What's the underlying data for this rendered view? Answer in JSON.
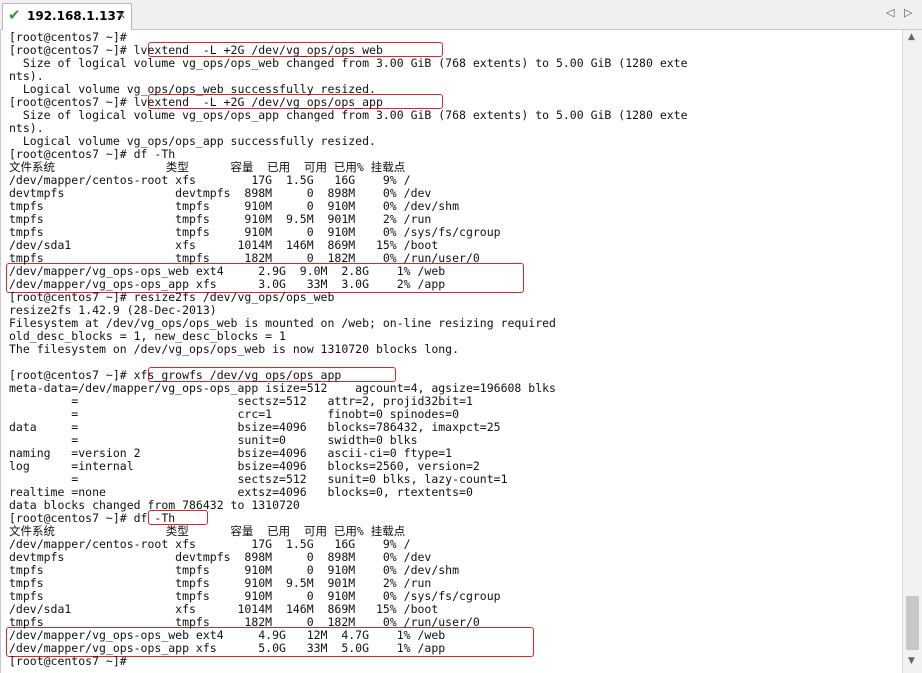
{
  "window": {
    "tab_title": "192.168.1.137",
    "tab_status_icon": "check-icon",
    "tab_close_icon": "close-icon",
    "nav_left_icon": "chevron-left-icon",
    "nav_right_icon": "chevron-right-icon",
    "highlight_color": "#d42a2a"
  },
  "terminal": {
    "lines": [
      "[root@centos7 ~]#",
      "[root@centos7 ~]# lvextend  -L +2G /dev/vg_ops/ops_web",
      "  Size of logical volume vg_ops/ops_web changed from 3.00 GiB (768 extents) to 5.00 GiB (1280 exte",
      "nts).",
      "  Logical volume vg_ops/ops_web successfully resized.",
      "[root@centos7 ~]# lvextend  -L +2G /dev/vg_ops/ops_app",
      "  Size of logical volume vg_ops/ops_app changed from 3.00 GiB (768 extents) to 5.00 GiB (1280 exte",
      "nts).",
      "  Logical volume vg_ops/ops_app successfully resized.",
      "[root@centos7 ~]# df -Th",
      "文件系统                类型      容量  已用  可用 已用% 挂载点",
      "/dev/mapper/centos-root xfs        17G  1.5G   16G    9% /",
      "devtmpfs                devtmpfs  898M     0  898M    0% /dev",
      "tmpfs                   tmpfs     910M     0  910M    0% /dev/shm",
      "tmpfs                   tmpfs     910M  9.5M  901M    2% /run",
      "tmpfs                   tmpfs     910M     0  910M    0% /sys/fs/cgroup",
      "/dev/sda1               xfs      1014M  146M  869M   15% /boot",
      "tmpfs                   tmpfs     182M     0  182M    0% /run/user/0",
      "/dev/mapper/vg_ops-ops_web ext4     2.9G  9.0M  2.8G    1% /web",
      "/dev/mapper/vg_ops-ops_app xfs      3.0G   33M  3.0G    2% /app",
      "[root@centos7 ~]# resize2fs /dev/vg_ops/ops_web",
      "resize2fs 1.42.9 (28-Dec-2013)",
      "Filesystem at /dev/vg_ops/ops_web is mounted on /web; on-line resizing required",
      "old_desc_blocks = 1, new_desc_blocks = 1",
      "The filesystem on /dev/vg_ops/ops_web is now 1310720 blocks long.",
      "",
      "[root@centos7 ~]# xfs_growfs /dev/vg_ops/ops_app",
      "meta-data=/dev/mapper/vg_ops-ops_app isize=512    agcount=4, agsize=196608 blks",
      "         =                       sectsz=512   attr=2, projid32bit=1",
      "         =                       crc=1        finobt=0 spinodes=0",
      "data     =                       bsize=4096   blocks=786432, imaxpct=25",
      "         =                       sunit=0      swidth=0 blks",
      "naming   =version 2              bsize=4096   ascii-ci=0 ftype=1",
      "log      =internal               bsize=4096   blocks=2560, version=2",
      "         =                       sectsz=512   sunit=0 blks, lazy-count=1",
      "realtime =none                   extsz=4096   blocks=0, rtextents=0",
      "data blocks changed from 786432 to 1310720",
      "[root@centos7 ~]# df -Th",
      "文件系统                类型      容量  已用  可用 已用% 挂载点",
      "/dev/mapper/centos-root xfs        17G  1.5G   16G    9% /",
      "devtmpfs                devtmpfs  898M     0  898M    0% /dev",
      "tmpfs                   tmpfs     910M     0  910M    0% /dev/shm",
      "tmpfs                   tmpfs     910M  9.5M  901M    2% /run",
      "tmpfs                   tmpfs     910M     0  910M    0% /sys/fs/cgroup",
      "/dev/sda1               xfs      1014M  146M  869M   15% /boot",
      "tmpfs                   tmpfs     182M     0  182M    0% /run/user/0",
      "/dev/mapper/vg_ops-ops_web ext4     4.9G   12M  4.7G    1% /web",
      "/dev/mapper/vg_ops-ops_app xfs      5.0G   33M  5.0G    1% /app",
      "[root@centos7 ~]#"
    ]
  },
  "scrollbar": {
    "up_icon": "arrow-up-icon",
    "down_icon": "arrow-down-icon"
  }
}
